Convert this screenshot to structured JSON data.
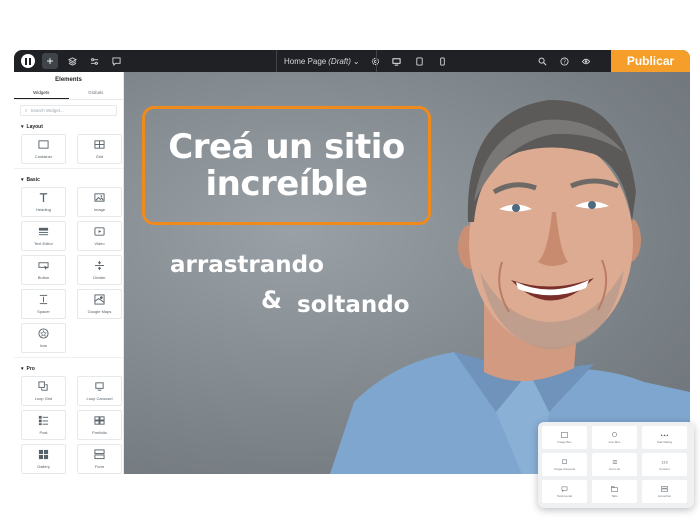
{
  "topbar": {
    "page_title": "Home Page",
    "page_status": "(Draft)",
    "publish_label": "Publicar"
  },
  "sidebar": {
    "title": "Elements",
    "tabs": [
      "Widgets",
      "Globals"
    ],
    "search_placeholder": "Search Widget...",
    "categories": [
      {
        "name": "Layout",
        "widgets": [
          "Container",
          "Grid"
        ]
      },
      {
        "name": "Basic",
        "widgets": [
          "Heading",
          "Image",
          "Text Editor",
          "Video",
          "Button",
          "Divider",
          "Spacer",
          "Google Maps",
          "Icon"
        ]
      },
      {
        "name": "Pro",
        "widgets": [
          "Loop Grid",
          "Loop Carousel",
          "Post",
          "Portfolio",
          "Gallery",
          "Form"
        ]
      }
    ]
  },
  "canvas": {
    "headline_line1": "Creá un sitio",
    "headline_line2": "increíble",
    "sub_line1": "arrastrando",
    "ampersand": "&",
    "sub_line2": "soltando",
    "accent_color": "#f08a1c"
  },
  "widget_card": {
    "items": [
      "Image Box",
      "Icon Box",
      "Star Rating",
      "Image Carousel",
      "Icon List",
      "Counter",
      "Testimonial",
      "Tabs",
      "Accordion"
    ]
  }
}
